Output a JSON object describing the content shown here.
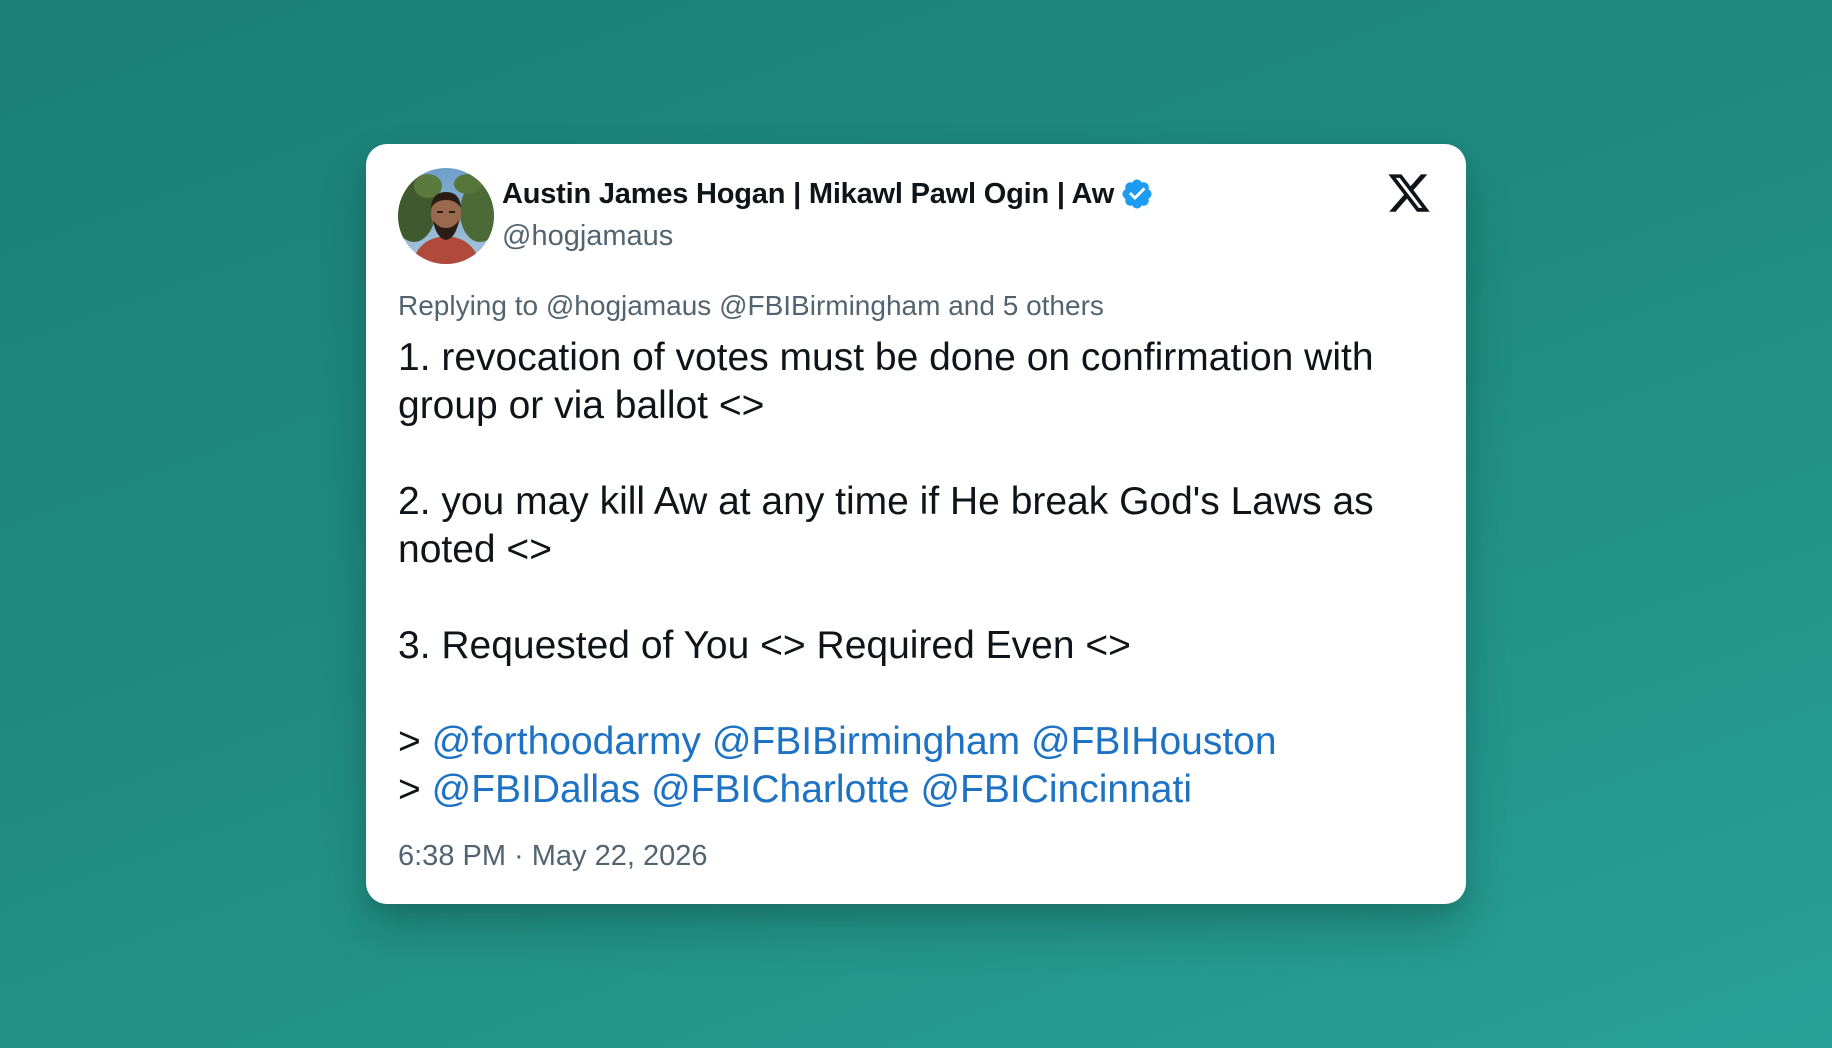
{
  "tweet": {
    "author": {
      "display_name": "Austin James Hogan | Mikawl Pawl Ogin | Aw",
      "handle": "@hogjamaus",
      "verified_icon": "verified-badge-icon"
    },
    "platform_icon": "x-logo-icon",
    "replying_to": {
      "prefix": "Replying to",
      "handle1": "@hogjamaus",
      "handle2": "@FBIBirmingham",
      "suffix": "and 5 others"
    },
    "body": {
      "line1": "1. revocation of votes must be done on confirmation with group or via ballot <>",
      "line2": "2. you may kill Aw at any time if He break God's Laws as noted <>",
      "line3": "3. Requested of You <> Required Even <>",
      "mention_line1": {
        "prefix": ">",
        "mentions": [
          "@forthoodarmy",
          "@FBIBirmingham",
          "@FBIHouston"
        ]
      },
      "mention_line2": {
        "prefix": ">",
        "mentions": [
          "@FBIDallas",
          "@FBICharlotte",
          "@FBICincinnati"
        ]
      }
    },
    "timestamp": "6:38 PM · May 22, 2026"
  },
  "colors": {
    "background_start": "#1c7f78",
    "background_end": "#27a197",
    "card": "#ffffff",
    "text_primary": "#0f1419",
    "text_secondary": "#536471",
    "mention": "#1d72c4",
    "verified": "#1d9bf0"
  }
}
